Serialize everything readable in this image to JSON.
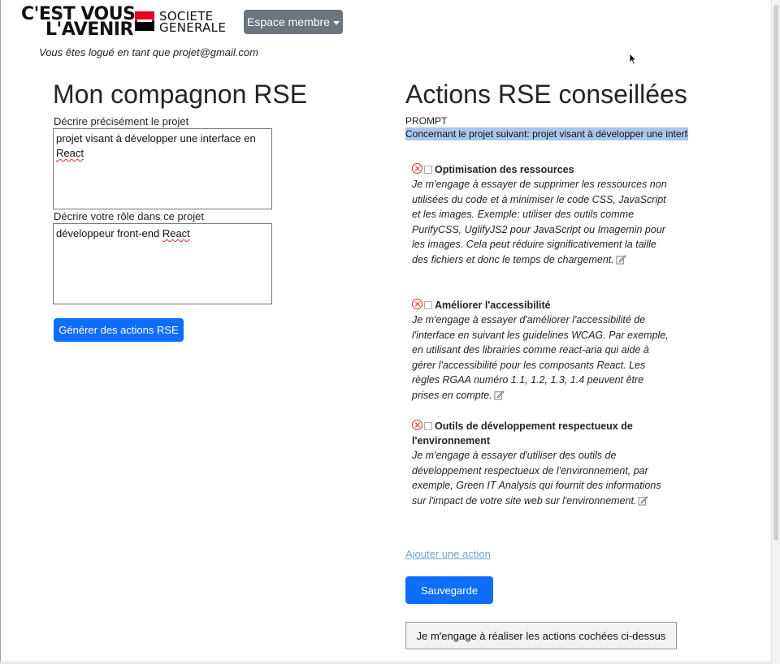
{
  "header": {
    "slogan_line1": "C'EST VOUS",
    "slogan_line2": "L'AVENIR",
    "brand_line1": "SOCIETE",
    "brand_line2": "GENERALE",
    "brand_colors": {
      "red": "#e60028",
      "black": "#000000"
    },
    "member_button": "Espace membre",
    "logged_in_text": "Vous êtes logué en tant que projet@gmail.com"
  },
  "left": {
    "title": "Mon compagnon RSE",
    "project_label": "Décrire précisément le projet",
    "project_value_plain": "projet visant à développer une interface en",
    "project_value_word": "React",
    "role_label": "Décrire votre rôle dans ce projet",
    "role_value_plain": "développeur front-end",
    "role_value_word": "React",
    "generate_button": "Générer des actions RSE"
  },
  "right": {
    "title": "Actions RSE conseillées",
    "prompt_label": "PROMPT",
    "prompt_value": "Concernant le projet suivant: projet visant à développer une interface en React",
    "actions": [
      {
        "title": "Optimisation des ressources",
        "body": "Je m'engage à essayer de supprimer les ressources non utilisées du code et à minimiser le code CSS, JavaScript et les images. Exemple: utiliser des outils comme PurifyCSS, UglifyJS2 pour JavaScript ou Imagemin pour les images. Cela peut réduire significativement la taille des fichiers et donc le temps de chargement."
      },
      {
        "title": "Améliorer l'accessibilité",
        "body": "Je m'engage à essayer d'améliorer l'accessibilité de l'interface en suivant les guidelines WCAG. Par exemple, en utilisant des librairies comme react-aria qui aide à gérer l'accessibilité pour les composants React. Les règles RGAA numéro 1.1, 1.2, 1.3, 1.4 peuvent être prises en compte."
      },
      {
        "title": "Outils de développement respectueux de l'environnement",
        "body": "Je m'engage à essayer d'utiliser des outils de développement respectueux de l'environnement, par exemple, Green IT Analysis qui fournit des informations sur l'impact de votre site web sur l'environnement."
      }
    ],
    "add_action_link": "Ajouter une action",
    "save_button": "Sauvegarde",
    "commit_button": "Je m'engage à réaliser les actions cochées ci-dessus"
  },
  "icons": {
    "remove": "x-circle-icon",
    "checkbox": "checkbox-icon",
    "edit": "edit-icon",
    "caret": "caret-down-icon",
    "cursor": "mouse-cursor-icon"
  },
  "theme": {
    "primary": "#0d6efd",
    "secondary": "#6c757d",
    "selection": "#a8c7ec",
    "danger": "#d93025"
  }
}
